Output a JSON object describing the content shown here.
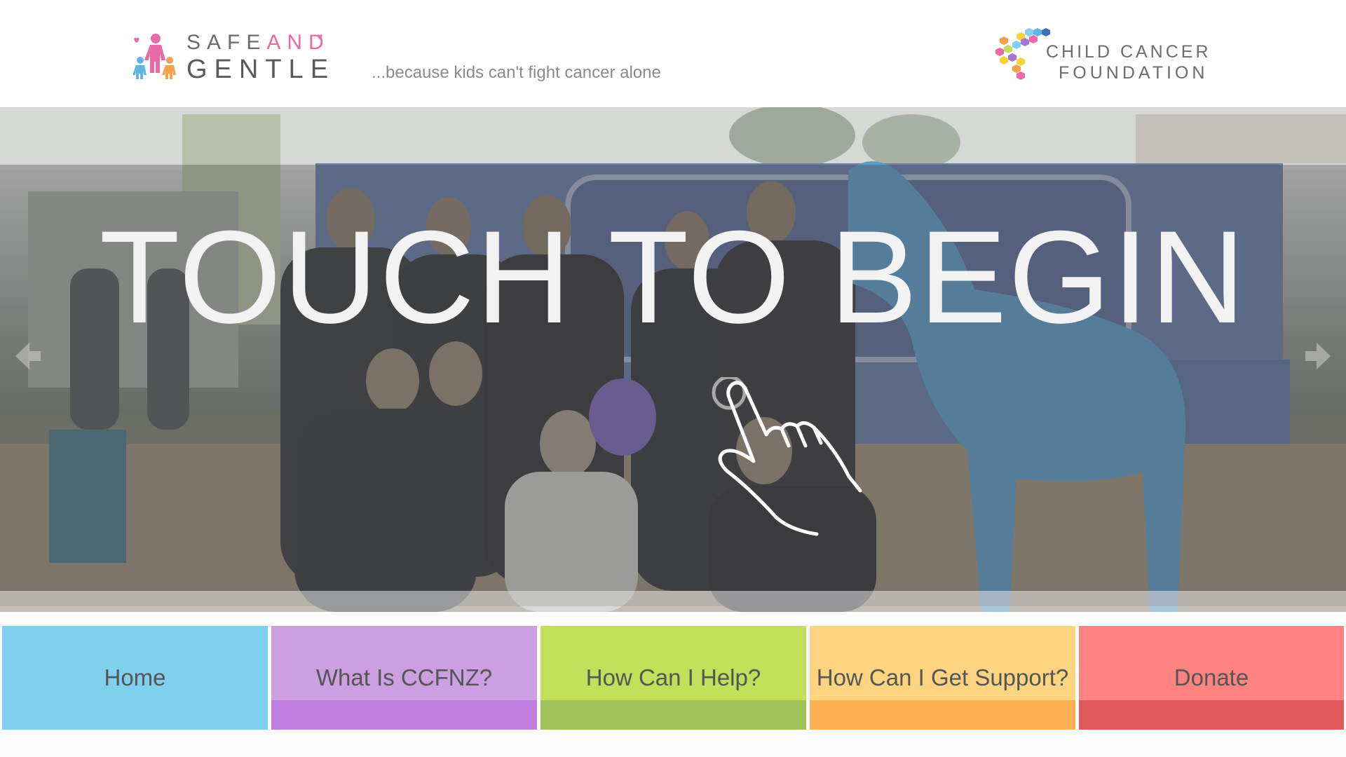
{
  "header": {
    "logo_left": {
      "word1": "SAFE",
      "word1_and": "AND",
      "word2": "GENTLE"
    },
    "tagline": "...because kids can't fight cancer alone",
    "logo_right": {
      "line1": "CHILD CANCER",
      "line2": "FOUNDATION"
    }
  },
  "hero": {
    "title": "TOUCH TO BEGIN",
    "prev_icon": "chevron-left-icon",
    "next_icon": "chevron-right-icon",
    "touch_icon": "hand-pointer-icon"
  },
  "nav": {
    "items": [
      {
        "label": "Home",
        "color_top": "#7fcfee",
        "color_bottom": "#7fcfee"
      },
      {
        "label": "What Is CCFNZ?",
        "color_top": "#cb9fe0",
        "color_bottom": "#c07fe0"
      },
      {
        "label": "How Can I Help?",
        "color_top": "#c2df5a",
        "color_bottom": "#a0c25a"
      },
      {
        "label": "How Can I Get Support?",
        "color_top": "#ffd480",
        "color_bottom": "#ffb052"
      },
      {
        "label": "Donate",
        "color_top": "#ff8480",
        "color_bottom": "#e05a5a"
      }
    ]
  },
  "colors": {
    "pink_accent": "#e96aa4",
    "text_gray": "#6b6b6b"
  }
}
